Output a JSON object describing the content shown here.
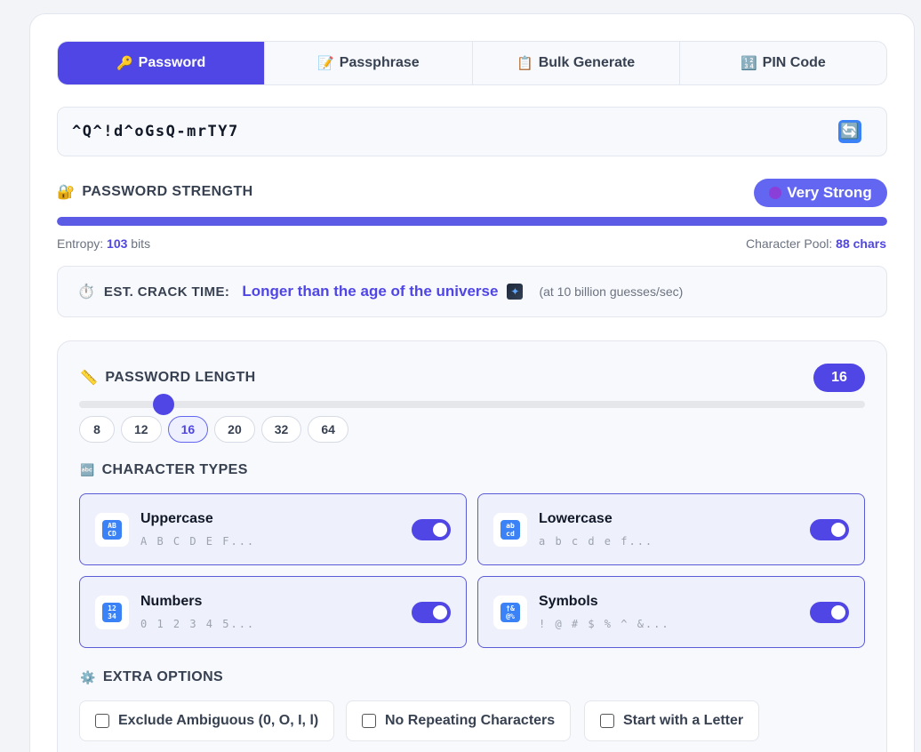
{
  "tabs": [
    {
      "icon": "🔑",
      "label": "Password",
      "active": true
    },
    {
      "icon": "📝",
      "label": "Passphrase",
      "active": false
    },
    {
      "icon": "📋",
      "label": "Bulk Generate",
      "active": false
    },
    {
      "icon": "🔢",
      "label": "PIN Code",
      "active": false
    }
  ],
  "password": {
    "value": "^Q^!d^oGsQ-mrTY7",
    "refresh_icon": "🔄"
  },
  "strength": {
    "title": "PASSWORD STRENGTH",
    "icon": "🔐",
    "badge": "Very Strong",
    "level": 1.0,
    "entropy_label": "Entropy:",
    "entropy_value": "103",
    "entropy_unit": "bits",
    "pool_label": "Character Pool:",
    "pool_value": "88 chars"
  },
  "crack": {
    "icon": "⏱️",
    "label": "EST. CRACK TIME:",
    "value": "Longer than the age of the universe",
    "note": "(at 10 billion guesses/sec)"
  },
  "length": {
    "icon": "📏",
    "title": "PASSWORD LENGTH",
    "value": "16",
    "slider_fraction": 0.108,
    "presets": [
      "8",
      "12",
      "16",
      "20",
      "32",
      "64"
    ],
    "active_preset": "16"
  },
  "char_types": {
    "icon": "🔤",
    "title": "CHARACTER TYPES",
    "items": [
      {
        "name": "Uppercase",
        "sample": "A B C D E F...",
        "tile": "AB CD",
        "enabled": true
      },
      {
        "name": "Lowercase",
        "sample": "a b c d e f...",
        "tile": "ab cd",
        "enabled": true
      },
      {
        "name": "Numbers",
        "sample": "0 1 2 3 4 5...",
        "tile": "12 34",
        "enabled": true
      },
      {
        "name": "Symbols",
        "sample": "! @ # $ % ^ &...",
        "tile": "†& @%",
        "enabled": true
      }
    ]
  },
  "extra": {
    "icon": "⚙️",
    "title": "EXTRA OPTIONS",
    "options": [
      {
        "label": "Exclude Ambiguous (0, O, I, l)",
        "checked": false
      },
      {
        "label": "No Repeating Characters",
        "checked": false
      },
      {
        "label": "Start with a Letter",
        "checked": false
      }
    ]
  }
}
